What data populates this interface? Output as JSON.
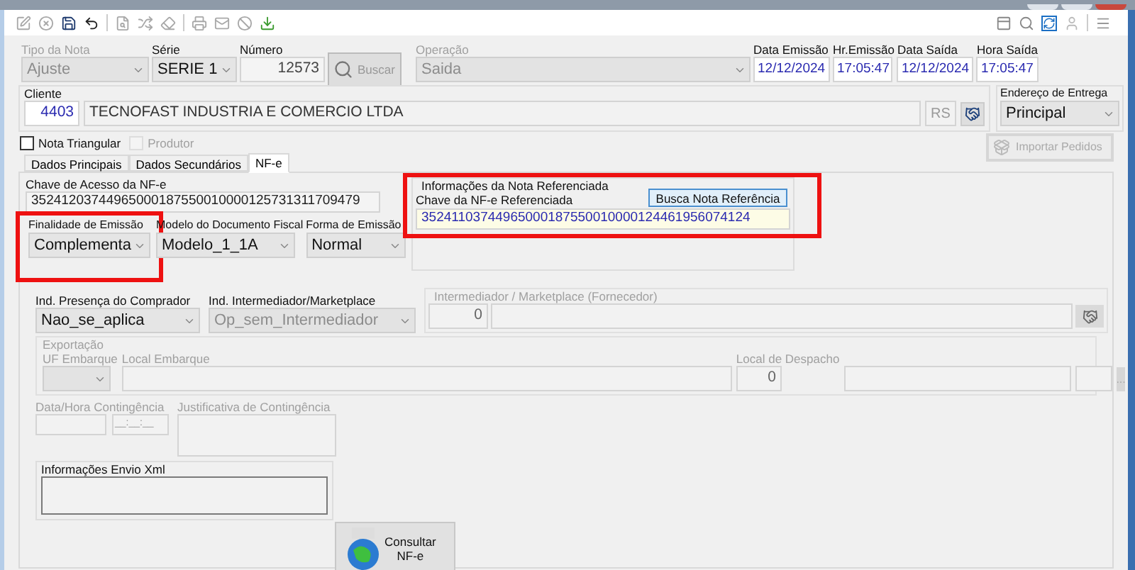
{
  "header": [
    {
      "kind": "combo",
      "label": "Tipo da Nota",
      "value": "Ajuste",
      "disabled": true
    },
    {
      "kind": "combo",
      "label": "Série",
      "value": "SERIE 1",
      "disabled": false
    },
    {
      "kind": "text",
      "label": "Número",
      "value": "12573",
      "disabled": false
    },
    {
      "kind": "button",
      "label": "Buscar",
      "disabled": true
    },
    {
      "kind": "combo",
      "label": "Operação",
      "value": "Saida",
      "disabled": true
    },
    {
      "kind": "date",
      "label": "Data Emissão",
      "value": "12/12/2024",
      "disabled": false
    },
    {
      "kind": "date",
      "label": "Hr.Emissão",
      "value": "17:05:47",
      "disabled": false
    },
    {
      "kind": "date",
      "label": "Data Saída",
      "value": "12/12/2024",
      "disabled": false
    },
    {
      "kind": "date",
      "label": "Hora Saída",
      "value": "17:05:47",
      "disabled": false
    }
  ],
  "cliente": {
    "title": "Cliente",
    "code": "4403",
    "name": "TECNOFAST INDUSTRIA E COMERCIO LTDA",
    "uf": "RS"
  },
  "endereco_entrega": {
    "title": "Endereço de Entrega",
    "value": "Principal"
  },
  "checkboxes": [
    {
      "label": "Nota Triangular",
      "checked": false,
      "disabled": false
    },
    {
      "label": "Produtor",
      "checked": false,
      "disabled": true
    }
  ],
  "importar_pedidos": {
    "label": "Importar Pedidos",
    "disabled": true
  },
  "tabs": [
    {
      "label": "Dados Principais",
      "selected": false
    },
    {
      "label": "Dados Secundários",
      "selected": false
    },
    {
      "label": "NF-e",
      "selected": true
    }
  ],
  "nfe": {
    "chave_acesso": {
      "label": "Chave de Acesso da NF-e",
      "value": "35241203744965000187550010000125731311709479"
    },
    "emissao_combos": [
      {
        "label": "Finalidade de Emissão",
        "value": "Complementa",
        "highlighted": true
      },
      {
        "label": "Modelo do Documento Fiscal",
        "value": "Modelo_1_1A",
        "highlighted": false
      },
      {
        "label": "Forma de Emissão",
        "value": "Normal",
        "highlighted": false
      }
    ],
    "nota_referenciada": {
      "title": "Informações da Nota Referenciada",
      "label": "Chave da NF-e Referenciada",
      "button": "Busca Nota Referência",
      "value": "35241103744965000187550010000124461956074124",
      "highlighted": true
    },
    "presenca": {
      "label": "Ind. Presença do Comprador",
      "value": "Nao_se_aplica",
      "disabled": false
    },
    "intermediador_ind": {
      "label": "Ind. Intermediador/Marketplace",
      "value": "Op_sem_Intermediador",
      "disabled": true
    },
    "intermediador": {
      "title": "Intermediador / Marketplace (Fornecedor)",
      "code": "0"
    },
    "exportacao": {
      "title": "Exportação",
      "uf_label": "UF Embarque",
      "local_label": "Local Embarque",
      "despacho_label": "Local de Despacho",
      "despacho_code": "0",
      "more_button": "..."
    },
    "contingencia": {
      "datetime_label": "Data/Hora Contingência",
      "time_mask": "__:__:__",
      "justificativa_label": "Justificativa de Contingência"
    },
    "envio_xml": {
      "title": "Informações Envio Xml"
    },
    "consultar": {
      "label_line1": "Consultar",
      "label_line2": "NF-e"
    }
  }
}
